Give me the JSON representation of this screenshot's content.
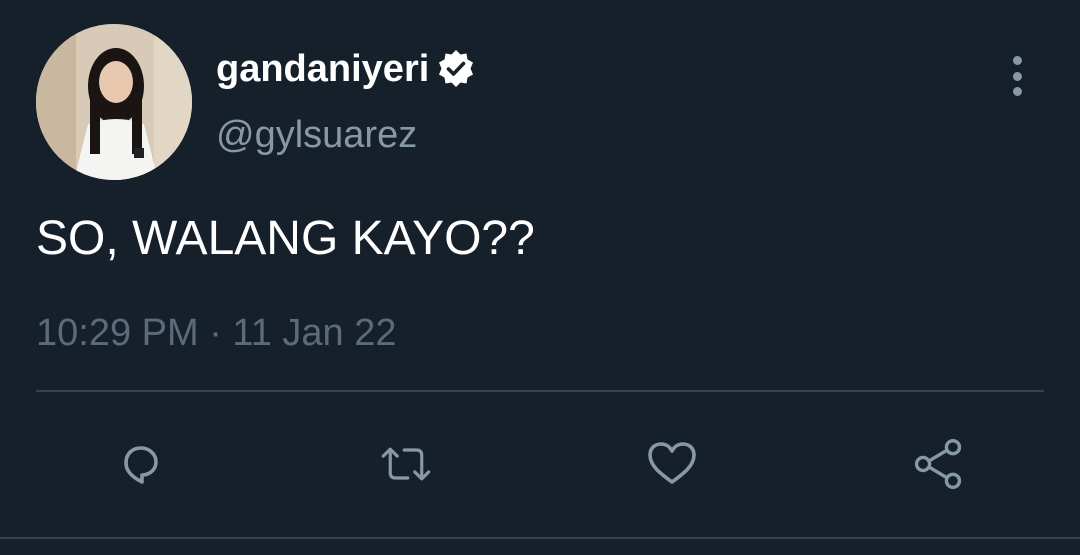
{
  "user": {
    "display_name": "gandaniyeri",
    "handle": "@gylsuarez",
    "verified": true,
    "avatar_icon": "profile-photo"
  },
  "tweet": {
    "text": "SO, WALANG KAYO??",
    "timestamp": "10:29 PM · 11 Jan 22"
  },
  "actions": {
    "icons": [
      "reply-icon",
      "retweet-icon",
      "like-icon",
      "share-icon"
    ]
  },
  "colors": {
    "background": "#15202b",
    "primary_text": "#ffffff",
    "secondary_text": "#8899a6",
    "divider": "#38444d"
  }
}
